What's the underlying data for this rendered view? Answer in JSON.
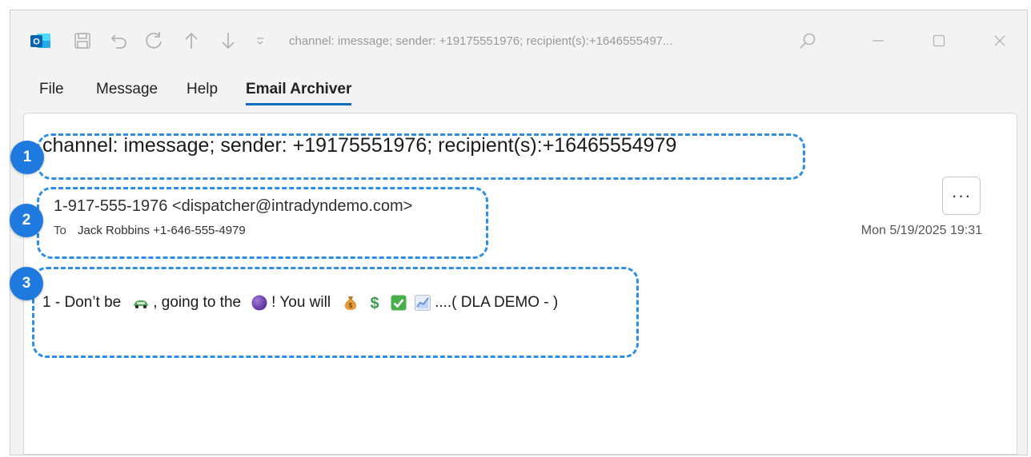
{
  "window": {
    "title": "channel: imessage; sender: +19175551976; recipient(s):+1646555497...",
    "app_icon": "outlook-icon",
    "toolbar_icons": [
      "save-icon",
      "undo-icon",
      "redo-icon",
      "up-arrow-icon",
      "down-arrow-icon",
      "customize-dropdown-icon"
    ],
    "window_controls": [
      "search-icon",
      "minimize-icon",
      "maximize-icon",
      "close-icon"
    ]
  },
  "menu": {
    "items": [
      {
        "label": "File"
      },
      {
        "label": "Message"
      },
      {
        "label": "Help"
      },
      {
        "label": "Email Archiver",
        "active": true
      }
    ]
  },
  "message": {
    "subject": "channel: imessage; sender: +19175551976; recipient(s):+16465554979",
    "sender": "1-917-555-1976 <dispatcher@intradyndemo.com>",
    "to_label": "To",
    "to_value": "Jack Robbins +1-646-555-4979",
    "date": "Mon 5/19/2025 19:31",
    "more_button": "···",
    "body": {
      "part1": "1 - Don’t be",
      "part2": ", going to the",
      "part3": "! You will",
      "part4": "....( DLA DEMO - )",
      "emojis": [
        "car-emoji",
        "purple-circle-emoji",
        "money-bag-emoji",
        "dollar-sign-emoji",
        "check-box-emoji",
        "chart-increasing-emoji"
      ]
    }
  },
  "annotations": {
    "badges": [
      "1",
      "2",
      "3"
    ],
    "color": "#2b8ee8",
    "badge_color": "#1f7ae0"
  },
  "colors": {
    "accent": "#0f6cbd",
    "window_bg": "#f3f3f3"
  }
}
